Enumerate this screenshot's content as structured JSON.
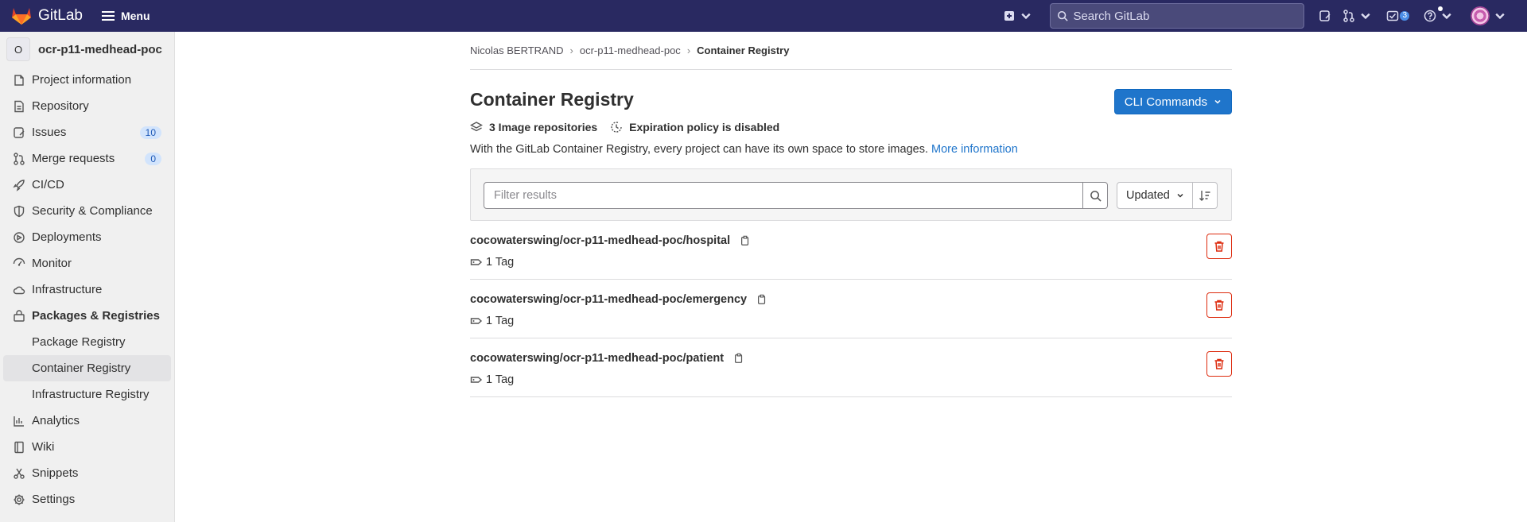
{
  "topbar": {
    "logo_text": "GitLab",
    "menu_label": "Menu",
    "search_placeholder": "Search GitLab",
    "todo_count": "3",
    "colors": {
      "background": "#292961",
      "accent": "#1f75cb"
    },
    "icons": [
      "plus-square-icon",
      "search-icon",
      "issues-icon",
      "merge-request-icon",
      "todo-icon",
      "help-icon",
      "user-avatar"
    ]
  },
  "sidebar": {
    "project_initial": "O",
    "project_name": "ocr-p11-medhead-poc",
    "items": [
      {
        "label": "Project information",
        "icon": "project-icon"
      },
      {
        "label": "Repository",
        "icon": "doc-text-icon"
      },
      {
        "label": "Issues",
        "icon": "issues-icon",
        "count": "10"
      },
      {
        "label": "Merge requests",
        "icon": "merge-request-icon",
        "count": "0"
      },
      {
        "label": "CI/CD",
        "icon": "rocket-icon"
      },
      {
        "label": "Security & Compliance",
        "icon": "shield-icon"
      },
      {
        "label": "Deployments",
        "icon": "deployments-icon"
      },
      {
        "label": "Monitor",
        "icon": "monitor-icon"
      },
      {
        "label": "Infrastructure",
        "icon": "cloud-icon"
      },
      {
        "label": "Packages & Registries",
        "icon": "package-icon"
      },
      {
        "label": "Package Registry"
      },
      {
        "label": "Container Registry"
      },
      {
        "label": "Infrastructure Registry"
      },
      {
        "label": "Analytics",
        "icon": "chart-icon"
      },
      {
        "label": "Wiki",
        "icon": "book-icon"
      },
      {
        "label": "Snippets",
        "icon": "snippet-icon"
      },
      {
        "label": "Settings",
        "icon": "settings-icon"
      }
    ]
  },
  "breadcrumb": {
    "items": [
      "Nicolas BERTRAND",
      "ocr-p11-medhead-poc",
      "Container Registry"
    ],
    "separator": "›"
  },
  "page": {
    "title": "Container Registry",
    "cli_button": "CLI Commands",
    "repo_count_label": "3 Image repositories",
    "expiration_label": "Expiration policy is disabled",
    "description": "With the GitLab Container Registry, every project can have its own space to store images.",
    "more_info": "More information"
  },
  "filter": {
    "placeholder": "Filter results",
    "sort_label": "Updated"
  },
  "repositories": [
    {
      "path": "cocowaterswing/ocr-p11-medhead-poc/hospital",
      "tags": "1 Tag"
    },
    {
      "path": "cocowaterswing/ocr-p11-medhead-poc/emergency",
      "tags": "1 Tag"
    },
    {
      "path": "cocowaterswing/ocr-p11-medhead-poc/patient",
      "tags": "1 Tag"
    }
  ]
}
